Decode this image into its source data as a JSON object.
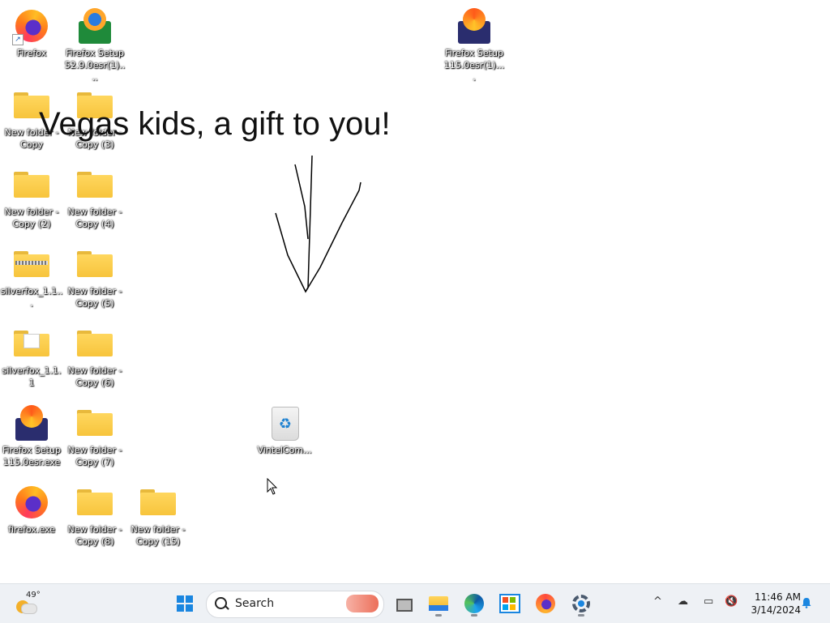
{
  "desktop": {
    "headline": "Vegas kids, a gift to you!",
    "icons": [
      {
        "label": "Firefox",
        "kind": "firefox"
      },
      {
        "label": "Firefox Setup 52.9.0esr(1)....",
        "kind": "setup52"
      },
      {
        "label": "Firefox Setup 115.0esr(1)....",
        "kind": "setup"
      },
      {
        "label": "New folder - Copy",
        "kind": "folder"
      },
      {
        "label": "New folder - Copy (3)",
        "kind": "folder"
      },
      {
        "label": "New folder - Copy (2)",
        "kind": "folder"
      },
      {
        "label": "New folder - Copy (4)",
        "kind": "folder"
      },
      {
        "label": "silverfox_1.1...",
        "kind": "zip"
      },
      {
        "label": "New folder - Copy (5)",
        "kind": "folder"
      },
      {
        "label": "silverfox_1.1.1",
        "kind": "folder-doc"
      },
      {
        "label": "New folder - Copy (6)",
        "kind": "folder"
      },
      {
        "label": "Firefox Setup 115.0esr.exe",
        "kind": "setup"
      },
      {
        "label": "New folder - Copy (7)",
        "kind": "folder"
      },
      {
        "label": "firefox.exe",
        "kind": "firefox"
      },
      {
        "label": "New folder - Copy (8)",
        "kind": "folder"
      },
      {
        "label": "New folder - Copy (15)",
        "kind": "folder"
      },
      {
        "label": "VintelCom...",
        "kind": "recycle-bin"
      }
    ]
  },
  "taskbar": {
    "weather": {
      "temp": "49°",
      "icon": "partly-cloudy-icon"
    },
    "search": {
      "placeholder": "Search"
    },
    "apps": [
      {
        "name": "start",
        "icon": "windows-icon"
      },
      {
        "name": "task-view",
        "icon": "task-view-icon"
      },
      {
        "name": "file-explorer",
        "icon": "folder-icon"
      },
      {
        "name": "edge",
        "icon": "edge-icon"
      },
      {
        "name": "microsoft-store",
        "icon": "store-icon"
      },
      {
        "name": "firefox",
        "icon": "firefox-icon"
      },
      {
        "name": "settings",
        "icon": "gear-icon"
      }
    ],
    "tray": {
      "chevron": "^",
      "time": "11:46 AM",
      "date": "3/14/2024"
    }
  },
  "colors": {
    "accent": "#1a86e0",
    "taskbar_bg": "#eef1f5",
    "folder": "#f7c43c"
  }
}
